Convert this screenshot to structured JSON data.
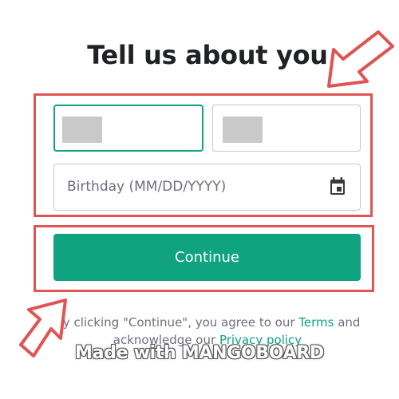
{
  "page": {
    "title": "Tell us about you"
  },
  "form": {
    "first_name_value": "",
    "last_name_value": "",
    "birthday_placeholder": "Birthday (MM/DD/YYYY)",
    "continue_label": "Continue"
  },
  "disclaimer": {
    "prefix": "By clicking \"Continue\", you agree to our ",
    "terms_link": "Terms",
    "middle": " and acknowledge our ",
    "privacy_link": "Privacy policy"
  },
  "watermark": {
    "text": "Made with MANGOBOARD"
  },
  "colors": {
    "accent": "#10a37f",
    "highlight": "#e05454",
    "title_text": "#202123",
    "muted_text": "#6e6e80"
  },
  "icons": {
    "calendar": "calendar-icon",
    "arrow_top": "arrow-pointer-icon",
    "arrow_bottom": "arrow-pointer-icon"
  }
}
